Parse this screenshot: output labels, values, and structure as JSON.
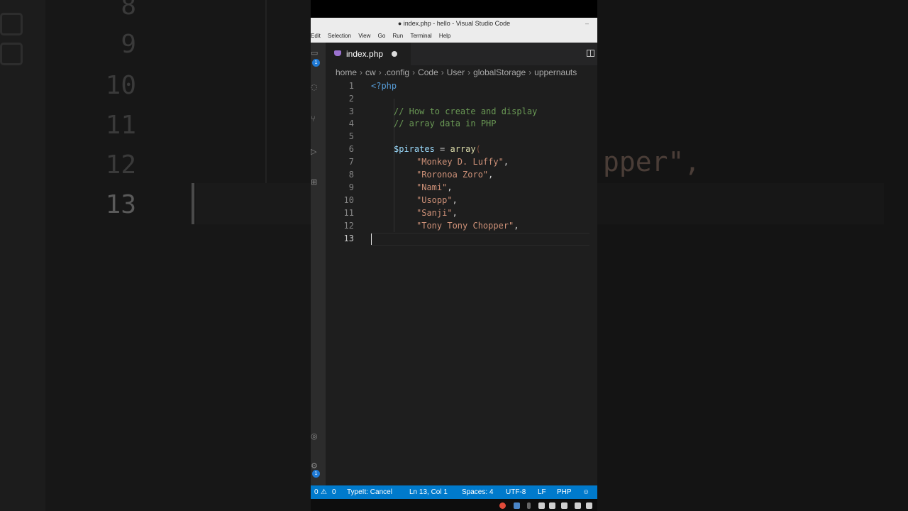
{
  "window": {
    "title": "● index.php - hello - Visual Studio Code",
    "minimize_glyph": "–"
  },
  "menu": [
    "Edit",
    "Selection",
    "View",
    "Go",
    "Run",
    "Terminal",
    "Help"
  ],
  "activity_bar": {
    "badges": [
      "1",
      "1"
    ],
    "icons": [
      "explorer-icon",
      "search-icon",
      "source-control-icon",
      "run-debug-icon",
      "extensions-icon",
      "account-icon",
      "settings-icon"
    ]
  },
  "tab": {
    "filename": "index.php",
    "modified": true,
    "icon": "php-elephant-icon"
  },
  "breadcrumb": [
    "home",
    "cw",
    ".config",
    "Code",
    "User",
    "globalStorage",
    "uppernauts"
  ],
  "code": {
    "line_numbers": [
      "1",
      "2",
      "3",
      "4",
      "5",
      "6",
      "7",
      "8",
      "9",
      "10",
      "11",
      "12",
      "13"
    ],
    "lines": {
      "l1": "<?php",
      "l3": "// How to create and display",
      "l4": "// array data in PHP",
      "l6_var": "$pirates",
      "l6_op": " = ",
      "l6_fn": "array",
      "l6_paren": "(",
      "l7": "\"Monkey D. Luffy\"",
      "l8": "\"Roronoa Zoro\"",
      "l9": "\"Nami\"",
      "l10": "\"Usopp\"",
      "l11": "\"Sanji\"",
      "l12": "\"Tony Tony Chopper\"",
      "comma": ","
    },
    "current_line": "13"
  },
  "status": {
    "errors": "0",
    "warnings": "0",
    "typeit": "TypeIt: Cancel",
    "position": "Ln 13, Col 1",
    "spaces": "Spaces: 4",
    "encoding": "UTF-8",
    "eol": "LF",
    "language": "PHP"
  },
  "background": {
    "line_numbers": [
      "8",
      "9",
      "10",
      "11",
      "12",
      "13"
    ],
    "code_fragment": "pper\","
  },
  "colors": {
    "accent": "#007acc",
    "editor_bg": "#1e1e1e",
    "string": "#ce9178",
    "comment": "#6a9955",
    "keyword": "#569cd6",
    "variable": "#9cdcfe"
  }
}
